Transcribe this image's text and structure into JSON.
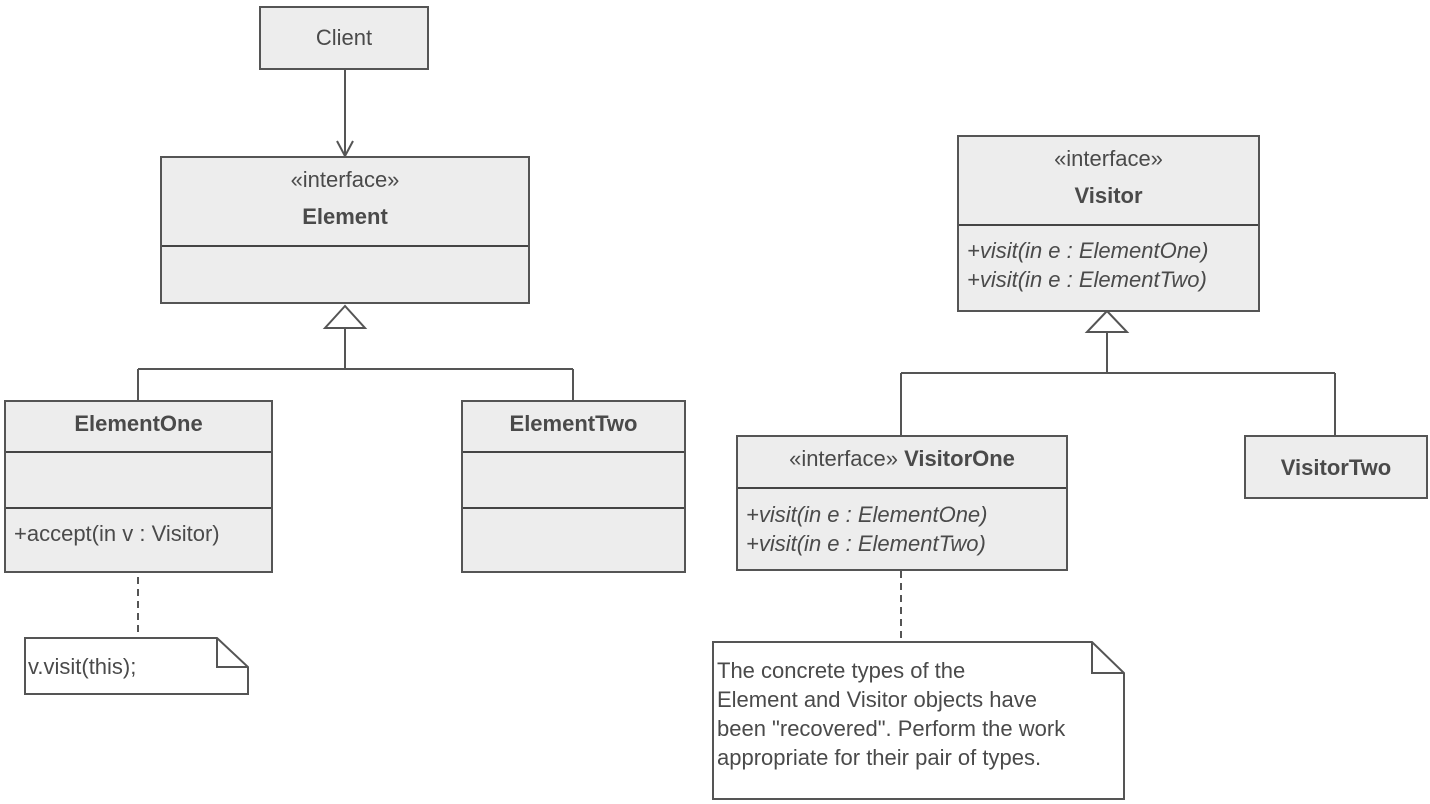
{
  "diagram": {
    "type": "UML class diagram",
    "pattern": "Visitor",
    "colors": {
      "fill": "#ededed",
      "stroke": "#555555",
      "text": "#4a4a4a",
      "note_fill": "#ffffff"
    },
    "classes": {
      "client": {
        "name": "Client"
      },
      "element": {
        "stereotype": "«interface»",
        "name": "Element"
      },
      "element_one": {
        "name": "ElementOne",
        "operations": [
          "+accept(in v : Visitor)"
        ]
      },
      "element_two": {
        "name": "ElementTwo"
      },
      "visitor": {
        "stereotype": "«interface»",
        "name": "Visitor",
        "operations": [
          "+visit(in e : ElementOne)",
          "+visit(in e : ElementTwo)"
        ]
      },
      "visitor_one": {
        "stereotype": "«interface»",
        "name": "VisitorOne",
        "operations": [
          "+visit(in e : ElementOne)",
          "+visit(in e : ElementTwo)"
        ]
      },
      "visitor_two": {
        "name": "VisitorTwo"
      }
    },
    "notes": {
      "accept_note": "v.visit(this);",
      "visitor_note": "The concrete types of the\nElement and Visitor objects have\nbeen \"recovered\". Perform the work\nappropriate for their pair of types."
    },
    "relationships": [
      {
        "type": "association",
        "from": "Client",
        "to": "Element"
      },
      {
        "type": "generalization",
        "from": "ElementOne",
        "to": "Element"
      },
      {
        "type": "generalization",
        "from": "ElementTwo",
        "to": "Element"
      },
      {
        "type": "generalization",
        "from": "VisitorOne",
        "to": "Visitor"
      },
      {
        "type": "generalization",
        "from": "VisitorTwo",
        "to": "Visitor"
      },
      {
        "type": "note-anchor",
        "from": "ElementOne",
        "to": "accept_note"
      },
      {
        "type": "note-anchor",
        "from": "VisitorOne",
        "to": "visitor_note"
      }
    ]
  }
}
